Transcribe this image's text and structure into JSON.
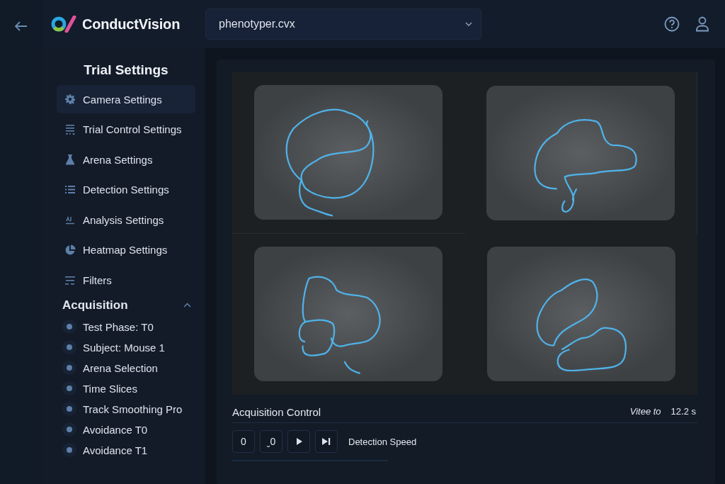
{
  "header": {
    "brand": "ConductVision",
    "file_select": {
      "value": "phenotyper.cvx"
    }
  },
  "sidebar": {
    "title": "Trial Settings",
    "items": [
      {
        "label": "Camera Settings",
        "selected": true
      },
      {
        "label": "Trial Control Settings",
        "selected": false
      },
      {
        "label": "Arena Settings",
        "selected": false
      },
      {
        "label": "Detection Settings",
        "selected": false
      },
      {
        "label": "Analysis Settings",
        "selected": false
      },
      {
        "label": "Heatmap Settings",
        "selected": false
      },
      {
        "label": "Filters",
        "selected": false
      }
    ],
    "section": {
      "title": "Acquisition",
      "expanded": true,
      "items": [
        "Test Phase: T0",
        "Subject: Mouse 1",
        "Arena Selection",
        "Time Slices",
        "Track Smoothing Pro",
        "Avoidance T0",
        "Avoidance T1"
      ]
    }
  },
  "acquisition_control": {
    "title": "Acquisition Control",
    "time_label": "Vitee to",
    "time_value": "12.2 s",
    "buttons": [
      {
        "kind": "text",
        "label": "0"
      },
      {
        "kind": "text",
        "label": "ˬ0"
      },
      {
        "kind": "play"
      },
      {
        "kind": "skip"
      }
    ],
    "speed_label": "Detection Speed"
  }
}
